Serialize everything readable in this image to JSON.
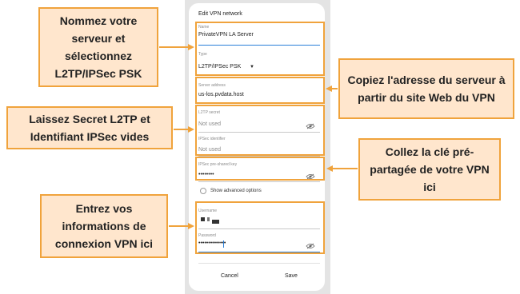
{
  "dialog": {
    "title": "Edit VPN network",
    "name_label": "Name",
    "name_value": "PrivateVPN LA Server",
    "type_label": "Type",
    "type_value": "L2TP/IPSec PSK",
    "server_label": "Server address",
    "server_value": "us-los.pvdata.host",
    "l2tp_label": "L2TP secret",
    "l2tp_value": "Not used",
    "ipsec_id_label": "IPSec identifier",
    "ipsec_id_value": "Not used",
    "psk_label": "IPSec pre-shared key",
    "psk_value": "••••••••",
    "advanced_label": "Show advanced options",
    "username_label": "Username",
    "password_label": "Password",
    "password_value": "••••••••••••••",
    "cancel_label": "Cancel",
    "save_label": "Save"
  },
  "callouts": {
    "name_server": "Nommez votre serveur et sélectionnez L2TP/IPSec PSK",
    "copy_address": "Copiez l'adresse du serveur à partir du site Web du VPN",
    "leave_empty": "Laissez Secret L2TP et Identifiant IPSec vides",
    "paste_key": "Collez la clé pré-partagée de votre VPN ici",
    "enter_login": "Entrez vos informations de connexion VPN ici"
  },
  "colors": {
    "accent_orange": "#f0a33c",
    "callout_fill": "#ffe6cd",
    "focus_blue": "#2a7fd8"
  }
}
